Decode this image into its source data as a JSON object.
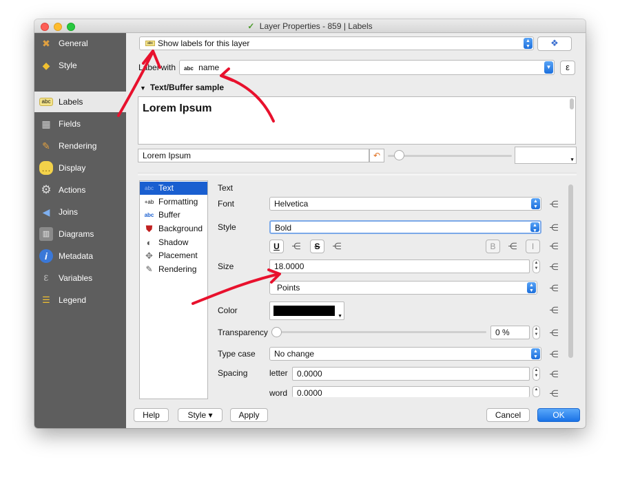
{
  "window": {
    "title": "Layer Properties - 859 | Labels"
  },
  "sidebar": {
    "items": [
      {
        "label": "General",
        "icon": "wrench-icon",
        "active": false
      },
      {
        "label": "Style",
        "icon": "brush-icon",
        "active": false
      },
      {
        "label": "Labels",
        "icon": "abc-label-icon",
        "active": true
      },
      {
        "label": "Fields",
        "icon": "table-icon",
        "active": false
      },
      {
        "label": "Rendering",
        "icon": "paintbrush-icon",
        "active": false
      },
      {
        "label": "Display",
        "icon": "speech-bubble-icon",
        "active": false
      },
      {
        "label": "Actions",
        "icon": "gear-icon",
        "active": false
      },
      {
        "label": "Joins",
        "icon": "join-arrow-icon",
        "active": false
      },
      {
        "label": "Diagrams",
        "icon": "chart-icon",
        "active": false
      },
      {
        "label": "Metadata",
        "icon": "info-icon",
        "active": false
      },
      {
        "label": "Variables",
        "icon": "epsilon-icon",
        "active": false
      },
      {
        "label": "Legend",
        "icon": "legend-icon",
        "active": false
      }
    ]
  },
  "top": {
    "mode_select": "Show labels for this layer",
    "label_with": "Label with",
    "label_field_prefix": "abc",
    "label_field": "name",
    "expression_button": "ε",
    "sample_header": "Text/Buffer sample",
    "sample_preview": "Lorem Ipsum",
    "sample_input": "Lorem Ipsum"
  },
  "tree": {
    "items": [
      {
        "label": "Text",
        "icon": "abc-text-icon",
        "active": true
      },
      {
        "label": "Formatting",
        "icon": "formatting-icon",
        "active": false
      },
      {
        "label": "Buffer",
        "icon": "abc-buffer-icon",
        "active": false
      },
      {
        "label": "Background",
        "icon": "background-shield-icon",
        "active": false
      },
      {
        "label": "Shadow",
        "icon": "shadow-icon",
        "active": false
      },
      {
        "label": "Placement",
        "icon": "placement-icon",
        "active": false
      },
      {
        "label": "Rendering",
        "icon": "rendering-brush-icon",
        "active": false
      }
    ]
  },
  "text_panel": {
    "heading": "Text",
    "font_label": "Font",
    "font_value": "Helvetica",
    "style_label": "Style",
    "style_value": "Bold",
    "underline": "U",
    "strike": "S",
    "bold": "B",
    "italic": "I",
    "size_label": "Size",
    "size_value": "18.0000",
    "size_unit": "Points",
    "color_label": "Color",
    "color_value": "#000000",
    "transparency_label": "Transparency",
    "transparency_value": "0 %",
    "transparency_fraction": 0,
    "type_case_label": "Type case",
    "type_case_value": "No change",
    "spacing_label": "Spacing",
    "letter_label": "letter",
    "letter_value": "0.0000",
    "word_label": "word",
    "word_value": "0.0000"
  },
  "footer": {
    "help": "Help",
    "style": "Style ▾",
    "apply": "Apply",
    "cancel": "Cancel",
    "ok": "OK"
  },
  "colors": {
    "accent": "#1a72e6",
    "sidebar": "#5e5e5e",
    "annotation": "#e8112d"
  }
}
